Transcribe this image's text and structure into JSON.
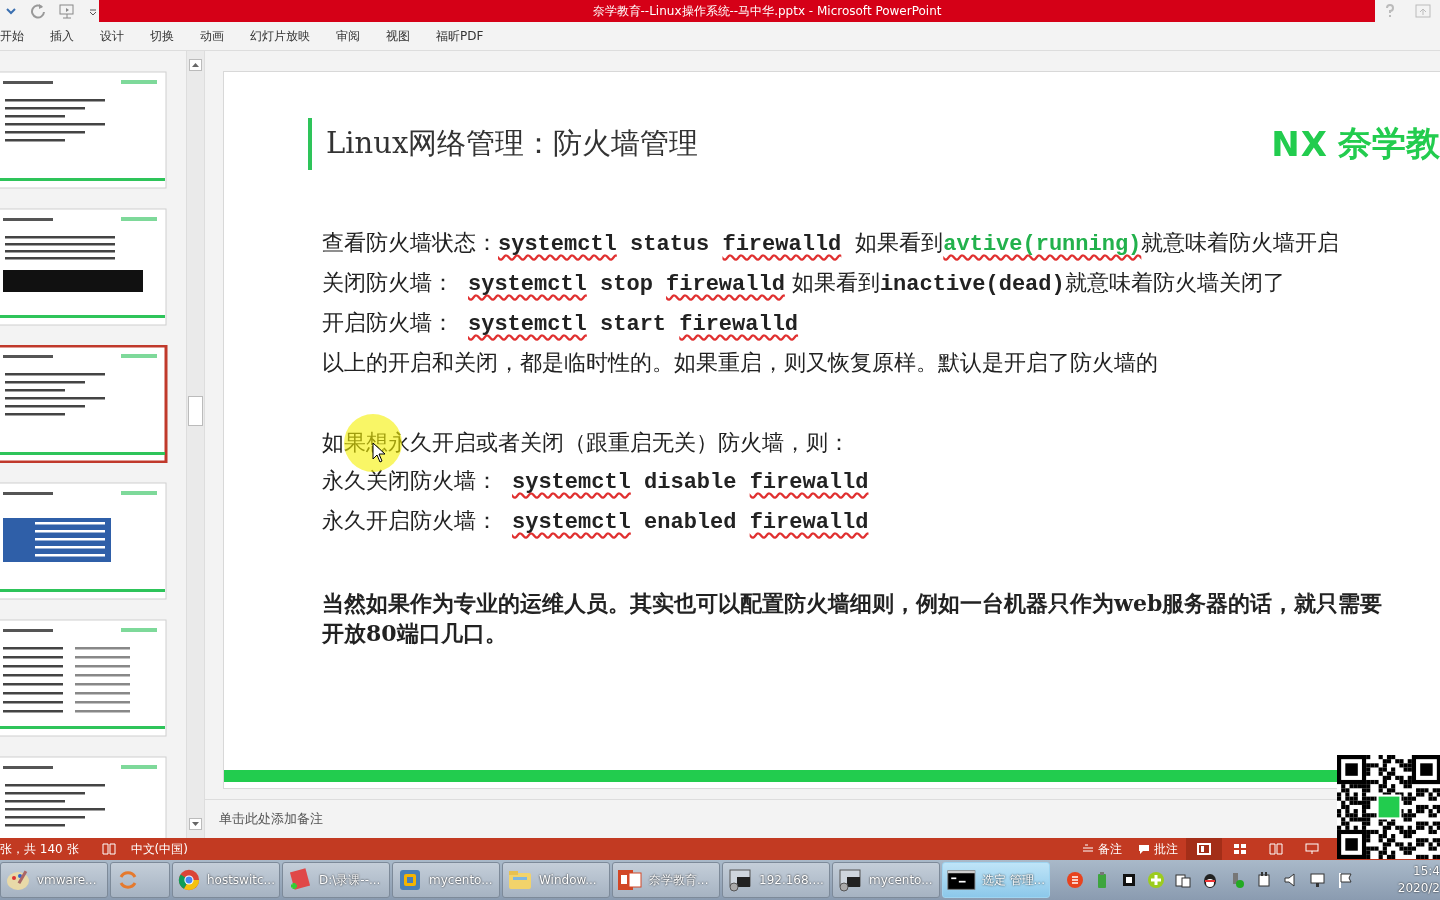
{
  "title_bar": {
    "title": "奈学教育--Linux操作系统--马中华.pptx -  Microsoft PowerPoint"
  },
  "ribbon_tabs": [
    "开始",
    "插入",
    "设计",
    "切换",
    "动画",
    "幻灯片放映",
    "审阅",
    "视图",
    "福昕PDF"
  ],
  "thumbnails": [
    {
      "kind": "text",
      "selected": false
    },
    {
      "kind": "terminal",
      "selected": false
    },
    {
      "kind": "text",
      "selected": true
    },
    {
      "kind": "table",
      "selected": false
    },
    {
      "kind": "columns",
      "selected": false
    },
    {
      "kind": "text",
      "selected": false
    }
  ],
  "slide": {
    "title": "Linux网络管理：防火墙管理",
    "logo_mark": "NX",
    "logo_text": "奈学教",
    "lines": [
      {
        "kind": "line",
        "segments": [
          {
            "kind": "zh",
            "text": "查看防火墙状态："
          },
          {
            "kind": "code-flagged",
            "text": "systemctl"
          },
          {
            "kind": "code",
            "text": " status "
          },
          {
            "kind": "code-flagged",
            "text": "firewalld"
          },
          {
            "kind": "zh",
            "text": "  如果看到"
          },
          {
            "kind": "green-flagged",
            "text": "avtive(running)"
          },
          {
            "kind": "zh",
            "text": "就意味着防火墙开启"
          }
        ]
      },
      {
        "kind": "line",
        "segments": [
          {
            "kind": "zh",
            "text": "关闭防火墙：  "
          },
          {
            "kind": "code-flagged",
            "text": "systemctl"
          },
          {
            "kind": "code",
            "text": " stop "
          },
          {
            "kind": "code-flagged",
            "text": "firewalld"
          },
          {
            "kind": "zh",
            "text": " 如果看到"
          },
          {
            "kind": "code",
            "text": "inactive(dead)"
          },
          {
            "kind": "zh",
            "text": "就意味着防火墙关闭了"
          }
        ]
      },
      {
        "kind": "line",
        "segments": [
          {
            "kind": "zh",
            "text": "开启防火墙：  "
          },
          {
            "kind": "code-flagged",
            "text": "systemctl"
          },
          {
            "kind": "code",
            "text": " start "
          },
          {
            "kind": "code-flagged",
            "text": "firewalld"
          }
        ]
      },
      {
        "kind": "line",
        "segments": [
          {
            "kind": "zh",
            "text": "以上的开启和关闭，都是临时性的。如果重启，则又恢复原样。默认是开启了防火墙的"
          }
        ]
      },
      {
        "kind": "gap"
      },
      {
        "kind": "line",
        "segments": [
          {
            "kind": "zh",
            "text": "如果想永久开启或者关闭（跟重启无关）防火墙，则："
          }
        ]
      },
      {
        "kind": "line",
        "segments": [
          {
            "kind": "zh",
            "text": "永久关闭防火墙：  "
          },
          {
            "kind": "code-flagged",
            "text": "systemctl"
          },
          {
            "kind": "code",
            "text": " disable "
          },
          {
            "kind": "code-flagged",
            "text": "firewalld"
          }
        ]
      },
      {
        "kind": "line",
        "segments": [
          {
            "kind": "zh",
            "text": "永久开启防火墙：  "
          },
          {
            "kind": "code-flagged",
            "text": "systemctl"
          },
          {
            "kind": "code",
            "text": " enabled "
          },
          {
            "kind": "code-flagged",
            "text": "firewalld"
          }
        ]
      },
      {
        "kind": "gap"
      },
      {
        "kind": "bold",
        "segments": [
          {
            "kind": "zh",
            "text": "当然如果作为专业的运维人员。其实也可以配置防火墙细则，例如一台机器只作为web服务器的话，就只需要开放80端口几口。"
          }
        ]
      }
    ]
  },
  "notes_placeholder": "单击此处添加备注",
  "status_bar": {
    "slide_count": "张，共 140 张",
    "language": "中文(中国)",
    "notes": "备注",
    "comments": "批注"
  },
  "taskbar": {
    "items": [
      {
        "kind": "paint",
        "label": "vmware...",
        "active": false
      },
      {
        "kind": "sync",
        "active": false
      },
      {
        "kind": "chrome",
        "label": "hostswitc...",
        "active": false
      },
      {
        "kind": "notepad",
        "label": "D:\\录课--...",
        "active": false
      },
      {
        "kind": "vmware",
        "label": "mycento...",
        "active": false
      },
      {
        "kind": "folder",
        "label": "Window...",
        "active": false
      },
      {
        "kind": "powerpoint",
        "label": "奈学教育...",
        "active": false
      },
      {
        "kind": "terminal",
        "label": "192.168....",
        "active": false
      },
      {
        "kind": "terminal",
        "label": "mycento...",
        "active": false
      },
      {
        "kind": "cmd",
        "label": "选定 管理...",
        "active": true
      }
    ],
    "clock_time": "15:4",
    "clock_date": "2020/2"
  }
}
